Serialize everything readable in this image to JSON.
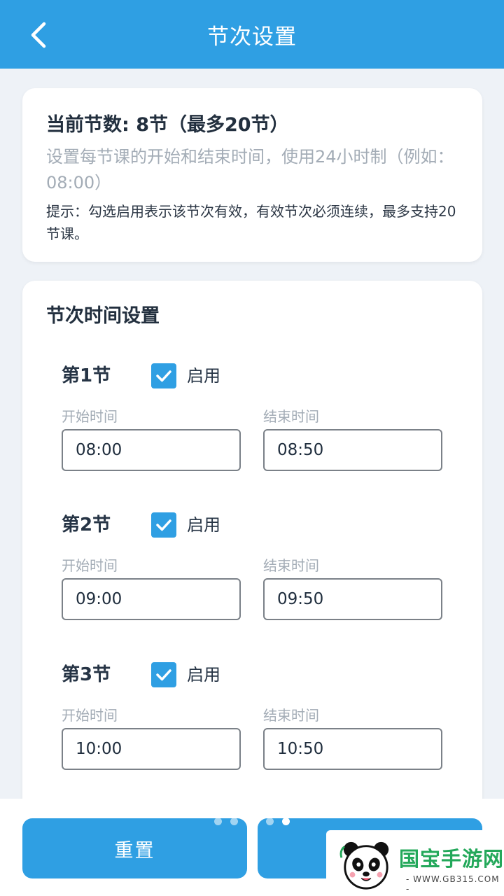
{
  "header": {
    "title": "节次设置"
  },
  "info": {
    "count_line": "当前节数: 8节（最多20节）",
    "description": "设置每节课的开始和结束时间，使用24小时制（例如：08:00）",
    "tip": "提示：勾选启用表示该节次有效，有效节次必须连续，最多支持20节课。"
  },
  "periods_section": {
    "title": "节次时间设置",
    "start_label": "开始时间",
    "end_label": "结束时间",
    "enable_label": "启用",
    "periods": [
      {
        "name": "第1节",
        "enabled": true,
        "start": "08:00",
        "end": "08:50"
      },
      {
        "name": "第2节",
        "enabled": true,
        "start": "09:00",
        "end": "09:50"
      },
      {
        "name": "第3节",
        "enabled": true,
        "start": "10:00",
        "end": "10:50"
      }
    ]
  },
  "actions": {
    "reset_label": "重置"
  },
  "watermark": {
    "brand": "国宝手游网",
    "site": "- WWW.GB315.COM -"
  },
  "colors": {
    "primary": "#2f9fe3",
    "background": "#eef2f7",
    "muted_text": "#a3acb6"
  }
}
